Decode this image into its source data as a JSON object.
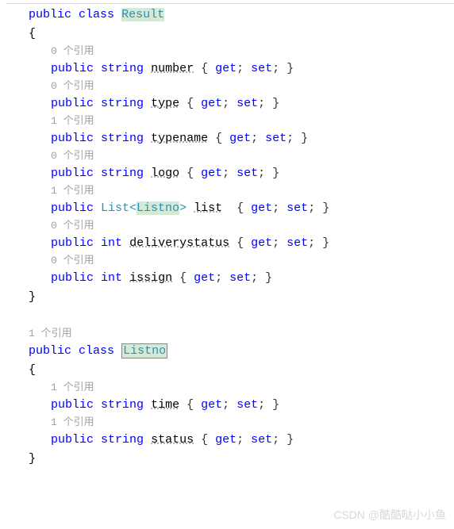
{
  "class1": {
    "decl_public": "public",
    "decl_class": "class",
    "name": "Result",
    "open_brace": "{",
    "close_brace": "}",
    "members": [
      {
        "ref": "0 个引用",
        "mod": "public",
        "rettype": "string",
        "name": "number",
        "accessor": "{ get; set; }"
      },
      {
        "ref": "0 个引用",
        "mod": "public",
        "rettype": "string",
        "name": "type",
        "accessor": "{ get; set; }"
      },
      {
        "ref": "1 个引用",
        "mod": "public",
        "rettype": "string",
        "name": "typename",
        "accessor": "{ get; set; }"
      },
      {
        "ref": "0 个引用",
        "mod": "public",
        "rettype": "string",
        "name": "logo",
        "accessor": "{ get; set; }"
      },
      {
        "ref": "1 个引用",
        "mod": "public",
        "rettype_prefix": "List<",
        "rettype_inner": "Listno",
        "rettype_suffix": ">",
        "name": "list",
        "accessor": " { get; set; }"
      },
      {
        "ref": "0 个引用",
        "mod": "public",
        "rettype": "int",
        "name": "deliverystatus",
        "accessor": "{ get; set; }"
      },
      {
        "ref": "0 个引用",
        "mod": "public",
        "rettype": "int",
        "name": "issign",
        "accessor": "{ get; set; }"
      }
    ]
  },
  "class2": {
    "ref": "1 个引用",
    "decl_public": "public",
    "decl_class": "class",
    "name": "Listno",
    "open_brace": "{",
    "close_brace": "}",
    "members": [
      {
        "ref": "1 个引用",
        "mod": "public",
        "rettype": "string",
        "name": "time",
        "accessor": "{ get; set; }"
      },
      {
        "ref": "1 个引用",
        "mod": "public",
        "rettype": "string",
        "name": "status",
        "accessor": "{ get; set; }"
      }
    ]
  },
  "watermark": "CSDN @酷酷哒小小鱼"
}
